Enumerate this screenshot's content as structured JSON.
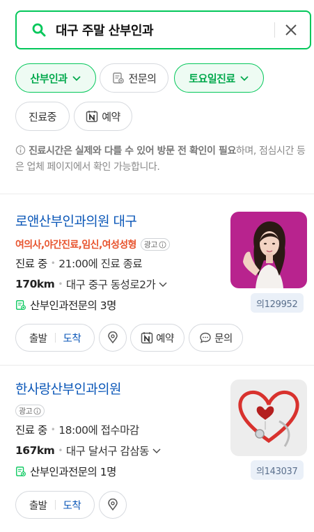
{
  "search": {
    "query": "대구 주말 산부인과"
  },
  "filters": {
    "row1": [
      {
        "label": "산부인과",
        "active": true,
        "has_chevron": true
      },
      {
        "label": "전문의",
        "active": false,
        "icon": "certificate-icon"
      },
      {
        "label": "토요일진료",
        "active": true,
        "has_chevron": true
      }
    ],
    "row2": [
      {
        "label": "진료중",
        "active": false
      },
      {
        "label": "예약",
        "active": false,
        "icon": "naver-booking-icon"
      }
    ]
  },
  "notice": {
    "bold_part": "진료시간은 실제와 다를 수 있어 방문 전 확인이 필요",
    "rest": "하며, 점심시간 등은 업체 페이지에서 확인 가능합니다."
  },
  "results": [
    {
      "name": "로앤산부인과의원 대구",
      "tags": "여의사,야간진료,임신,여성성형",
      "ad_label": "광고",
      "status": "진료 중",
      "hours": "21:00에 진료 종료",
      "distance": "170km",
      "address": "대구 중구 동성로2가",
      "specialists": "산부인과전문의 3명",
      "review_id": "의129952",
      "buttons": {
        "depart": "출발",
        "arrive": "도착",
        "booking": "예약",
        "inquiry": "문의"
      }
    },
    {
      "name": "한사랑산부인과의원",
      "ad_label": "광고",
      "status": "진료 중",
      "hours": "18:00에 접수마감",
      "distance": "167km",
      "address": "대구 달서구 감삼동",
      "specialists": "산부인과전문의 1명",
      "review_id": "의143037",
      "buttons": {
        "depart": "출발",
        "arrive": "도착"
      }
    }
  ],
  "colors": {
    "accent": "#03c75a",
    "link": "#0b57b8",
    "tag": "#e8542e"
  }
}
